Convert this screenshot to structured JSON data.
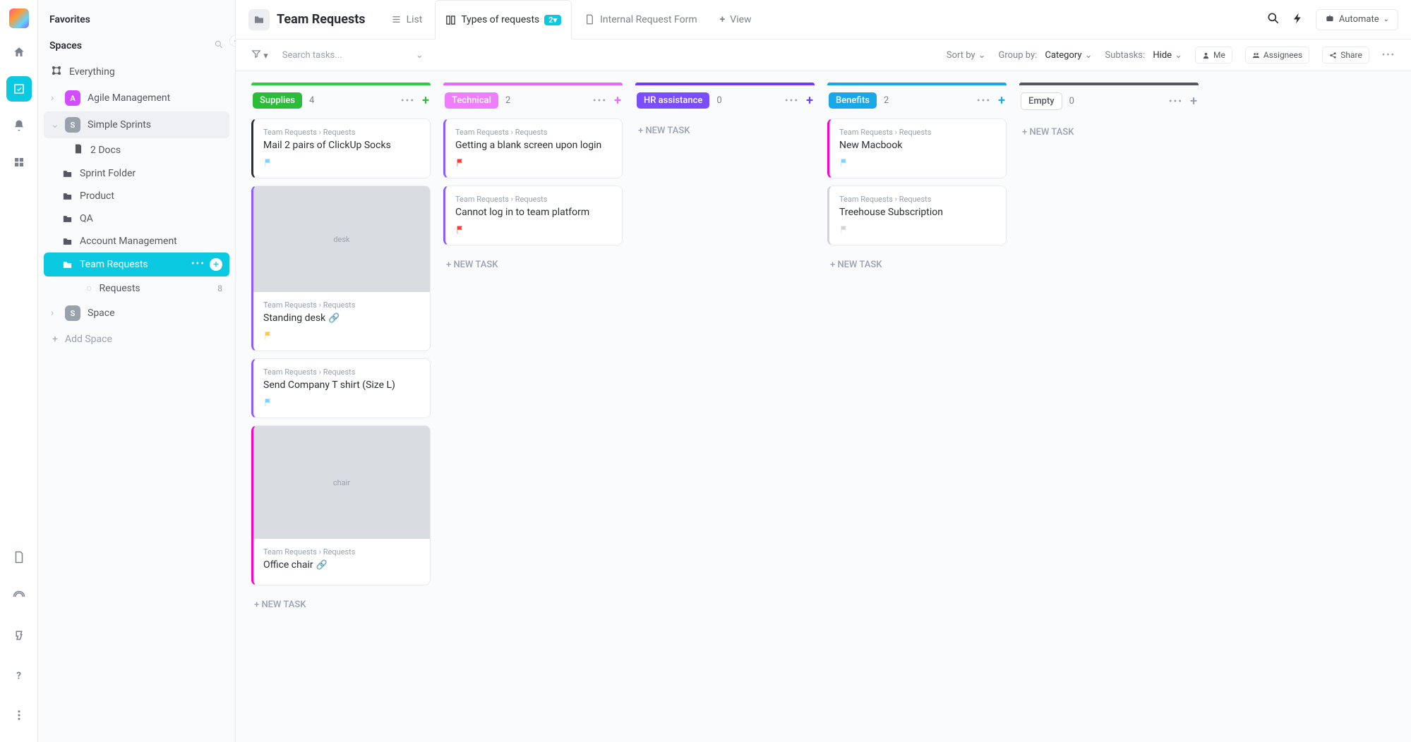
{
  "sidebar": {
    "favorites_label": "Favorites",
    "spaces_label": "Spaces",
    "everything": "Everything",
    "agile": "Agile Management",
    "simple_sprints": "Simple Sprints",
    "docs": "2 Docs",
    "sprint_folder": "Sprint Folder",
    "product": "Product",
    "qa": "QA",
    "account_mgmt": "Account Management",
    "team_requests": "Team Requests",
    "requests": "Requests",
    "requests_count": "8",
    "space": "Space",
    "add_space": "Add Space"
  },
  "header": {
    "title": "Team Requests",
    "tab_list": "List",
    "tab_types": "Types of requests",
    "tab_types_badge": "2▾",
    "tab_form": "Internal Request Form",
    "tab_view": "View",
    "automate": "Automate"
  },
  "toolbar": {
    "search_placeholder": "Search tasks...",
    "sort_by": "Sort by",
    "group_by_label": "Group by:",
    "group_by_value": "Category",
    "subtasks_label": "Subtasks:",
    "subtasks_value": "Hide",
    "me": "Me",
    "assignees": "Assignees",
    "share": "Share"
  },
  "lanes": [
    {
      "id": "supplies",
      "name": "Supplies",
      "count": "4",
      "color": "#2ecc40",
      "pill_bg": "#2bbd3a",
      "plus_color": "#2bbd3a",
      "cards": [
        {
          "title": "Mail 2 pairs of ClickUp Socks",
          "flag": "#7cd3ff",
          "accent": "#292d34"
        },
        {
          "title": "Standing desk",
          "flag": "#f5c945",
          "accent": "#8a5eff",
          "image": "desk",
          "attach": true
        },
        {
          "title": "Send Company T shirt (Size L)",
          "flag": "#7cd3ff",
          "accent": "#8a5eff"
        },
        {
          "title": "Office chair",
          "flag": null,
          "accent": "#ff00c8",
          "image": "chair",
          "attach": true
        }
      ]
    },
    {
      "id": "technical",
      "name": "Technical",
      "count": "2",
      "color": "#e768ff",
      "pill_bg": "#ef7dff",
      "plus_color": "#e768ff",
      "cards": [
        {
          "title": "Getting a blank screen upon login",
          "flag": "#ff3b30",
          "accent": "#8a5eff"
        },
        {
          "title": "Cannot log in to team platform",
          "flag": "#ff3b30",
          "accent": "#8a5eff"
        }
      ]
    },
    {
      "id": "hr",
      "name": "HR assistance",
      "count": "0",
      "color": "#6f3cff",
      "pill_bg": "#7a4dff",
      "plus_color": "#6f3cff",
      "cards": []
    },
    {
      "id": "benefits",
      "name": "Benefits",
      "count": "2",
      "color": "#1aa7e8",
      "pill_bg": "#1aa7e8",
      "plus_color": "#1aa7e8",
      "cards": [
        {
          "title": "New Macbook",
          "flag": "#7cd3ff",
          "accent": "#ff00c8"
        },
        {
          "title": "Treehouse Subscription",
          "flag": "#d0d4da",
          "accent": "#d0d4da"
        }
      ]
    },
    {
      "id": "empty",
      "name": "Empty",
      "count": "0",
      "color": "#54575d",
      "pill_bg": "outline",
      "plus_color": "#99a1ad",
      "cards": []
    }
  ],
  "card_crumb": {
    "root": "Team Requests",
    "sep": "›",
    "leaf": "Requests"
  },
  "new_task": "+ NEW TASK"
}
